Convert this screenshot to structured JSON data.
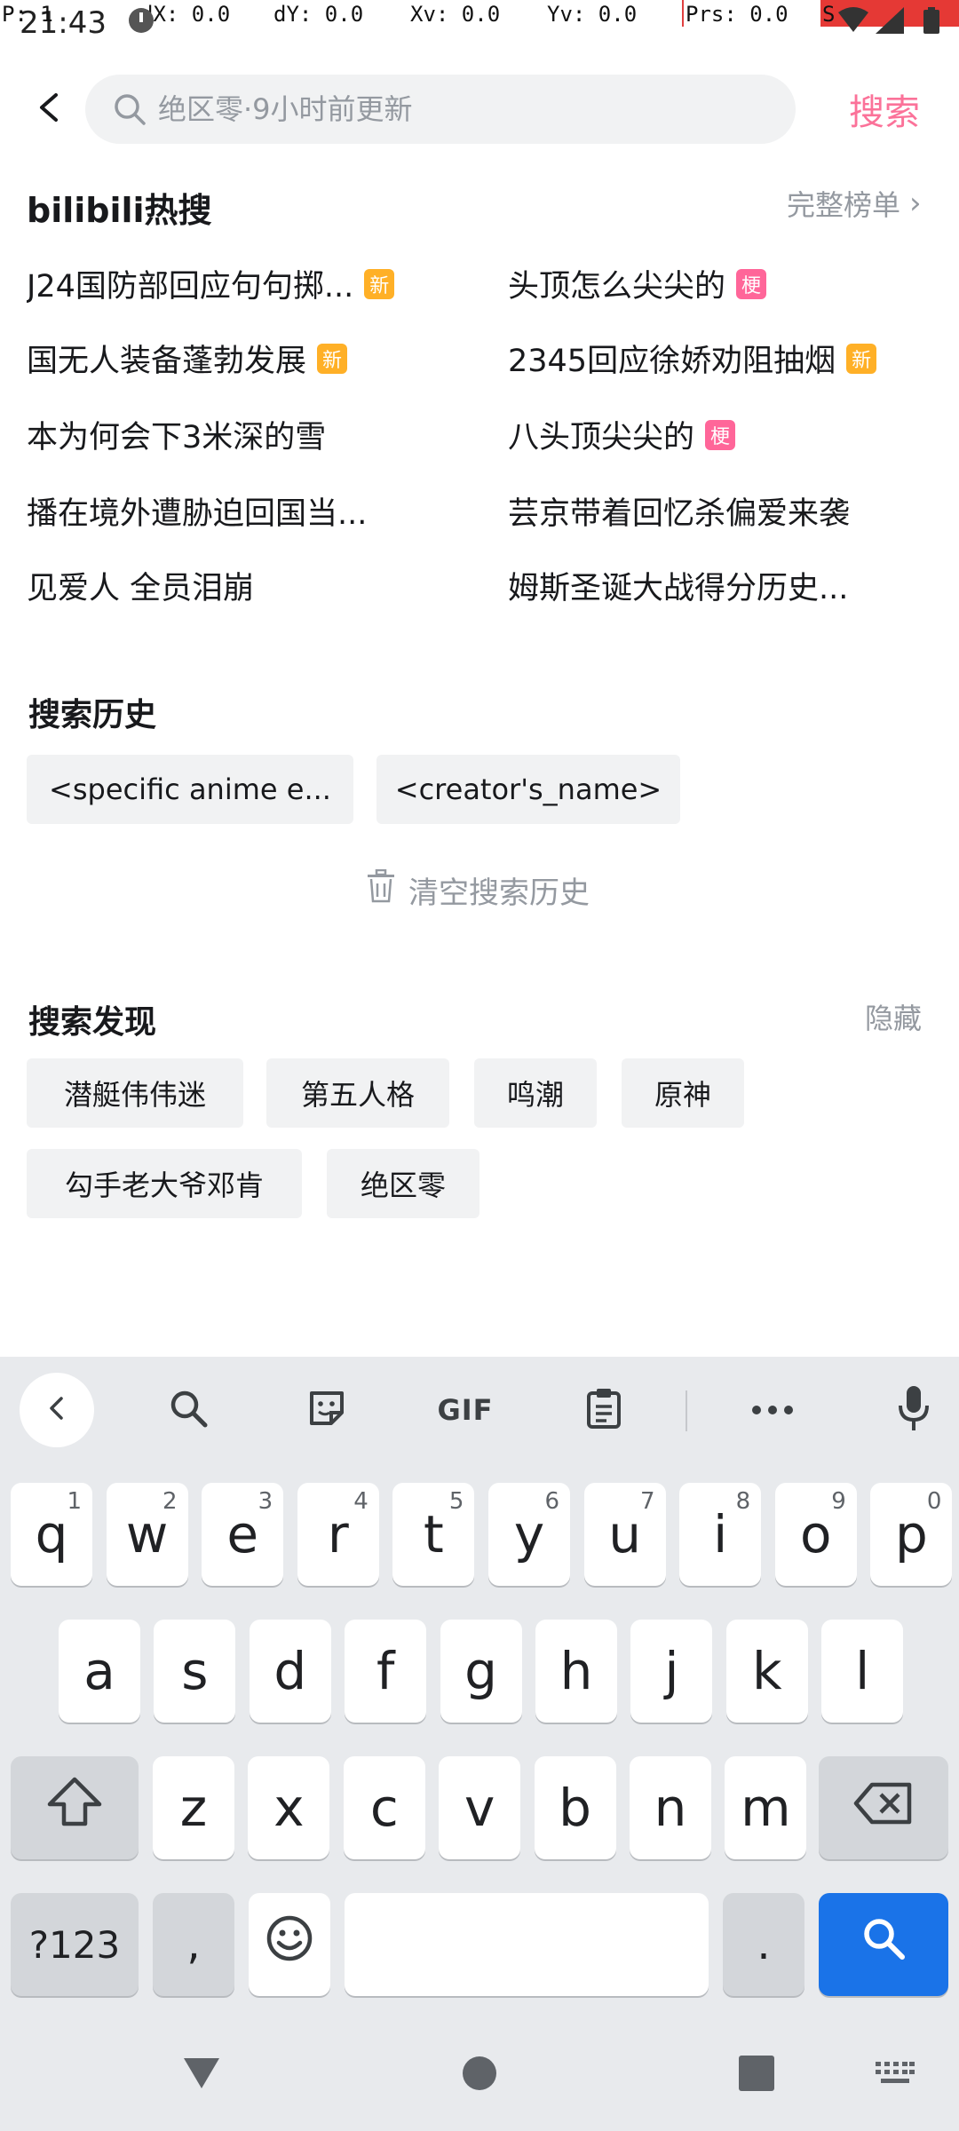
{
  "status_bar": {
    "time": "21:43",
    "debug": {
      "p": "P: 1",
      "dx": "dX: 0.0",
      "dy": "dY: 0.0",
      "xv": "Xv: 0.0",
      "yv": "Yv: 0.0",
      "prs": "Prs: 0.0",
      "s": "S"
    },
    "icons": [
      "alarm-icon",
      "wifi-icon",
      "signal-icon",
      "battery-icon"
    ]
  },
  "search": {
    "placeholder": "绝区零·9小时前更新",
    "submit_label": "搜索"
  },
  "hot_search": {
    "title": "bilibili热搜",
    "full_list_label": "完整榜单",
    "items": [
      {
        "text": "J24国防部回应句句掷...",
        "badge": "新"
      },
      {
        "text": "头顶怎么尖尖的",
        "badge": "梗"
      },
      {
        "text": "国无人装备蓬勃发展",
        "badge": "新"
      },
      {
        "text": "2345回应徐娇劝阻抽烟",
        "badge": "新"
      },
      {
        "text": "本为何会下3米深的雪",
        "badge": ""
      },
      {
        "text": "八头顶尖尖的",
        "badge": "梗"
      },
      {
        "text": "播在境外遭胁迫回国当...",
        "badge": ""
      },
      {
        "text": "芸京带着回忆杀偏爱来袭",
        "badge": ""
      },
      {
        "text": "见爱人 全员泪崩",
        "badge": ""
      },
      {
        "text": "姆斯圣诞大战得分历史...",
        "badge": ""
      }
    ]
  },
  "history": {
    "title": "搜索历史",
    "items": [
      "<specific anime e...",
      "<creator's_name>"
    ],
    "clear_label": "清空搜索历史"
  },
  "discover": {
    "title": "搜索发现",
    "hide_label": "隐藏",
    "items": [
      "潜艇伟伟迷",
      "第五人格",
      "鸣潮",
      "原神",
      "勾手老大爷邓肯",
      "绝区零"
    ]
  },
  "keyboard": {
    "toolbar": [
      "back-icon",
      "search-icon",
      "sticker-icon",
      "gif-icon",
      "clipboard-icon",
      "more-icon",
      "mic-icon"
    ],
    "gif_label": "GIF",
    "row1": [
      {
        "k": "q",
        "h": "1"
      },
      {
        "k": "w",
        "h": "2"
      },
      {
        "k": "e",
        "h": "3"
      },
      {
        "k": "r",
        "h": "4"
      },
      {
        "k": "t",
        "h": "5"
      },
      {
        "k": "y",
        "h": "6"
      },
      {
        "k": "u",
        "h": "7"
      },
      {
        "k": "i",
        "h": "8"
      },
      {
        "k": "o",
        "h": "9"
      },
      {
        "k": "p",
        "h": "0"
      }
    ],
    "row2": [
      "a",
      "s",
      "d",
      "f",
      "g",
      "h",
      "j",
      "k",
      "l"
    ],
    "row3": [
      "z",
      "x",
      "c",
      "v",
      "b",
      "n",
      "m"
    ],
    "symbols_label": "?123",
    "comma_label": ",",
    "period_label": ".",
    "accent_color": "#1a73e8"
  },
  "nav_bar": {
    "icons": [
      "back-triangle-icon",
      "home-circle-icon",
      "recents-square-icon",
      "keyboard-switch-icon"
    ]
  },
  "colors": {
    "brand_pink": "#fb7299",
    "badge_new": "#ffb027",
    "badge_meme": "#ff6699",
    "secondary_text": "#9499a0"
  }
}
